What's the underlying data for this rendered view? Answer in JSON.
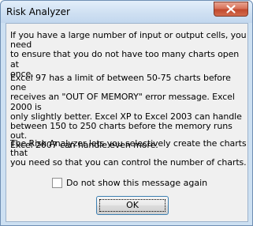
{
  "window": {
    "title": "Risk Analyzer"
  },
  "icons": {
    "close": "close-icon"
  },
  "colors": {
    "close_button": "#c24a2e",
    "client_bg": "#f0f0f0",
    "frame": "#cde0f2"
  },
  "message": {
    "paragraph1": "If you have a large number of input or output cells, you need\nto ensure that you do not have too many charts open at\nonce.",
    "paragraph2": "Excel 97 has a limit of between 50-75 charts before one\nreceives an \"OUT OF MEMORY\" error message.  Excel 2000 is\nonly slightly better.  Excel XP to Excel 2003 can handle\nbetween 150 to 250 charts before the memory runs out.\nExcel 2007 can handle even more.",
    "paragraph3": "The Risk Analyzer lets you selectively create the charts that\nyou need so that you can control the number of charts."
  },
  "dont_show": {
    "label": "Do not show this message again",
    "checked": false
  },
  "buttons": {
    "ok": "OK"
  }
}
